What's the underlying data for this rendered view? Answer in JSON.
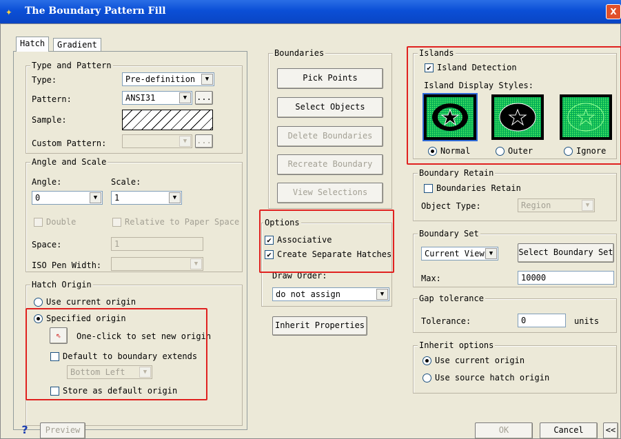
{
  "window": {
    "title": "The Boundary Pattern Fill",
    "close": "X"
  },
  "tabs": [
    "Hatch",
    "Gradient"
  ],
  "type_pattern": {
    "title": "Type and Pattern",
    "type_label": "Type:",
    "type_value": "Pre-definition",
    "pattern_label": "Pattern:",
    "pattern_value": "ANSI31",
    "browse": "...",
    "sample_label": "Sample:",
    "custom_label": "Custom Pattern:"
  },
  "angle_scale": {
    "title": "Angle and Scale",
    "angle_label": "Angle:",
    "angle_value": "0",
    "scale_label": "Scale:",
    "scale_value": "1",
    "double_label": "Double",
    "relative_label": "Relative to Paper Space",
    "space_label": "Space:",
    "space_value": "1",
    "iso_label": "ISO Pen Width:"
  },
  "hatch_origin": {
    "title": "Hatch Origin",
    "use_current": "Use current origin",
    "specified": "Specified origin",
    "one_click": "One-click to set new origin",
    "default_boundary": "Default to boundary extends",
    "position_value": "Bottom Left",
    "store_default": "Store as default origin"
  },
  "boundaries": {
    "title": "Boundaries",
    "pick_points": "Pick Points",
    "select_objects": "Select Objects",
    "delete_boundaries": "Delete Boundaries",
    "recreate_boundary": "Recreate Boundary",
    "view_selections": "View Selections"
  },
  "options": {
    "title": "Options",
    "associative": "Associative",
    "separate": "Create Separate Hatches",
    "draw_order_label": "Draw Order:",
    "draw_order_value": "do not assign",
    "inherit_btn": "Inherit Properties"
  },
  "islands": {
    "title": "Islands",
    "detection": "Island Detection",
    "styles_label": "Island Display Styles:",
    "normal": "Normal",
    "outer": "Outer",
    "ignore": "Ignore"
  },
  "boundary_retain": {
    "title": "Boundary Retain",
    "retain": "Boundaries Retain",
    "object_type_label": "Object Type:",
    "object_type_value": "Region"
  },
  "boundary_set": {
    "title": "Boundary Set",
    "set_value": "Current Viewp",
    "select_btn": "Select Boundary Set",
    "max_label": "Max:",
    "max_value": "10000"
  },
  "gap": {
    "title": "Gap tolerance",
    "tol_label": "Tolerance:",
    "tol_value": "0",
    "units": "units"
  },
  "inherit_options": {
    "title": "Inherit options",
    "use_current": "Use current origin",
    "use_source": "Use source hatch origin"
  },
  "footer": {
    "help": "?",
    "preview": "Preview",
    "ok": "OK",
    "cancel": "Cancel",
    "more": "<<"
  }
}
